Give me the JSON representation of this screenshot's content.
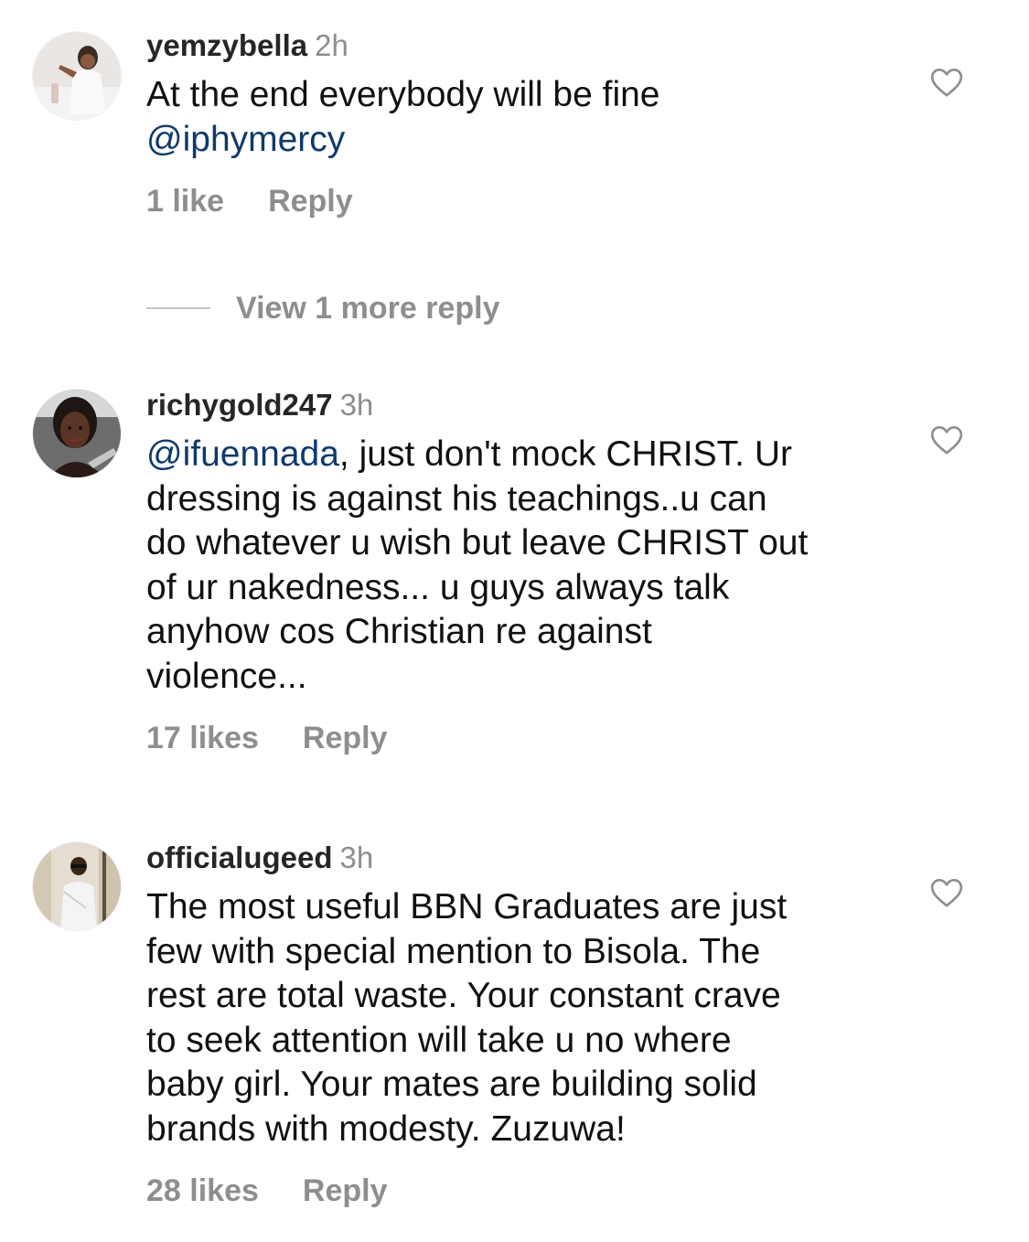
{
  "colors": {
    "mention": "#0e3a6b",
    "muted": "#8e8e8e",
    "text": "#111111"
  },
  "comments": [
    {
      "username": "yemzybella",
      "time": "2h",
      "lines": [
        [
          {
            "t": "At the end everybody will be fine"
          }
        ],
        [
          {
            "t": "@iphymercy",
            "mention": true
          }
        ]
      ],
      "likes": "1 like",
      "reply": "Reply",
      "icon": "heart-outline-icon"
    },
    {
      "username": "richygold247",
      "time": "3h",
      "lines": [
        [
          {
            "t": "@ifuennada",
            "mention": true
          },
          {
            "t": ", just don't mock CHRIST. Ur"
          }
        ],
        [
          {
            "t": "dressing is against his teachings..u can"
          }
        ],
        [
          {
            "t": "do whatever u wish but leave CHRIST out"
          }
        ],
        [
          {
            "t": "of ur nakedness... u guys always talk"
          }
        ],
        [
          {
            "t": "anyhow cos Christian re against"
          }
        ],
        [
          {
            "t": "violence..."
          }
        ]
      ],
      "likes": "17 likes",
      "reply": "Reply",
      "icon": "heart-outline-icon"
    },
    {
      "username": "officialugeed",
      "time": "3h",
      "lines": [
        [
          {
            "t": "The most useful BBN Graduates are just"
          }
        ],
        [
          {
            "t": "few with special mention to Bisola. The"
          }
        ],
        [
          {
            "t": "rest are total waste. Your constant crave"
          }
        ],
        [
          {
            "t": "to seek attention will take u no where"
          }
        ],
        [
          {
            "t": "baby girl. Your mates are building solid"
          }
        ],
        [
          {
            "t": "brands with modesty. Zuzuwa!"
          }
        ]
      ],
      "likes": "28 likes",
      "reply": "Reply",
      "icon": "heart-outline-icon"
    }
  ],
  "view_more": {
    "label": "View 1 more reply"
  }
}
